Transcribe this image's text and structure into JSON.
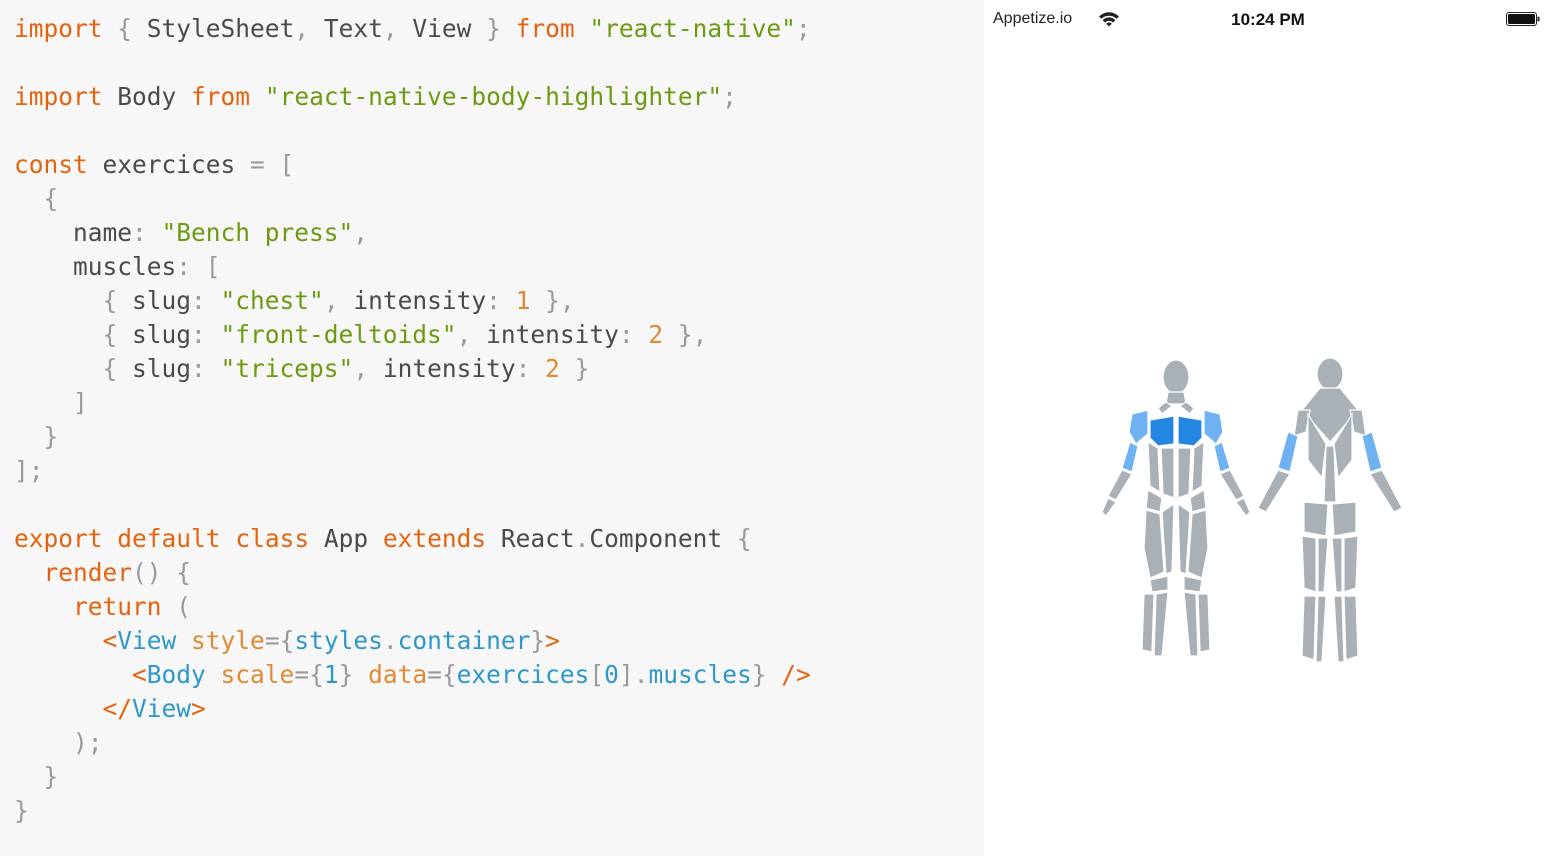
{
  "editor": {
    "lines": [
      [
        {
          "t": "import",
          "c": "kw"
        },
        {
          "t": " { ",
          "c": "punc"
        },
        {
          "t": "StyleSheet",
          "c": "id"
        },
        {
          "t": ", ",
          "c": "punc"
        },
        {
          "t": "Text",
          "c": "id"
        },
        {
          "t": ", ",
          "c": "punc"
        },
        {
          "t": "View",
          "c": "id"
        },
        {
          "t": " } ",
          "c": "punc"
        },
        {
          "t": "from",
          "c": "kw"
        },
        {
          "t": " ",
          "c": "id"
        },
        {
          "t": "\"react-native\"",
          "c": "str"
        },
        {
          "t": ";",
          "c": "punc"
        }
      ],
      [],
      [
        {
          "t": "import",
          "c": "kw"
        },
        {
          "t": " Body ",
          "c": "id"
        },
        {
          "t": "from",
          "c": "kw"
        },
        {
          "t": " ",
          "c": "id"
        },
        {
          "t": "\"react-native-body-highlighter\"",
          "c": "str"
        },
        {
          "t": ";",
          "c": "punc"
        }
      ],
      [],
      [
        {
          "t": "const",
          "c": "kw"
        },
        {
          "t": " exercices ",
          "c": "id"
        },
        {
          "t": "= [",
          "c": "punc"
        }
      ],
      [
        {
          "t": "  {",
          "c": "punc"
        }
      ],
      [
        {
          "t": "    name",
          "c": "id"
        },
        {
          "t": ": ",
          "c": "punc"
        },
        {
          "t": "\"Bench press\"",
          "c": "str"
        },
        {
          "t": ",",
          "c": "punc"
        }
      ],
      [
        {
          "t": "    muscles",
          "c": "id"
        },
        {
          "t": ": [",
          "c": "punc"
        }
      ],
      [
        {
          "t": "      { ",
          "c": "punc"
        },
        {
          "t": "slug",
          "c": "id"
        },
        {
          "t": ": ",
          "c": "punc"
        },
        {
          "t": "\"chest\"",
          "c": "str"
        },
        {
          "t": ", ",
          "c": "punc"
        },
        {
          "t": "intensity",
          "c": "id"
        },
        {
          "t": ": ",
          "c": "punc"
        },
        {
          "t": "1",
          "c": "num"
        },
        {
          "t": " },",
          "c": "punc"
        }
      ],
      [
        {
          "t": "      { ",
          "c": "punc"
        },
        {
          "t": "slug",
          "c": "id"
        },
        {
          "t": ": ",
          "c": "punc"
        },
        {
          "t": "\"front-deltoids\"",
          "c": "str"
        },
        {
          "t": ", ",
          "c": "punc"
        },
        {
          "t": "intensity",
          "c": "id"
        },
        {
          "t": ": ",
          "c": "punc"
        },
        {
          "t": "2",
          "c": "num"
        },
        {
          "t": " },",
          "c": "punc"
        }
      ],
      [
        {
          "t": "      { ",
          "c": "punc"
        },
        {
          "t": "slug",
          "c": "id"
        },
        {
          "t": ": ",
          "c": "punc"
        },
        {
          "t": "\"triceps\"",
          "c": "str"
        },
        {
          "t": ", ",
          "c": "punc"
        },
        {
          "t": "intensity",
          "c": "id"
        },
        {
          "t": ": ",
          "c": "punc"
        },
        {
          "t": "2",
          "c": "num"
        },
        {
          "t": " }",
          "c": "punc"
        }
      ],
      [
        {
          "t": "    ]",
          "c": "punc"
        }
      ],
      [
        {
          "t": "  }",
          "c": "punc"
        }
      ],
      [
        {
          "t": "];",
          "c": "punc"
        }
      ],
      [],
      [
        {
          "t": "export",
          "c": "kw"
        },
        {
          "t": " ",
          "c": "id"
        },
        {
          "t": "default",
          "c": "kw"
        },
        {
          "t": " ",
          "c": "id"
        },
        {
          "t": "class",
          "c": "kw"
        },
        {
          "t": " App ",
          "c": "id"
        },
        {
          "t": "extends",
          "c": "kw"
        },
        {
          "t": " React",
          "c": "id"
        },
        {
          "t": ".",
          "c": "punc"
        },
        {
          "t": "Component",
          "c": "id"
        },
        {
          "t": " {",
          "c": "punc"
        }
      ],
      [
        {
          "t": "  ",
          "c": "id"
        },
        {
          "t": "render",
          "c": "kw"
        },
        {
          "t": "() {",
          "c": "punc"
        }
      ],
      [
        {
          "t": "    ",
          "c": "id"
        },
        {
          "t": "return",
          "c": "kw"
        },
        {
          "t": " (",
          "c": "punc"
        }
      ],
      [
        {
          "t": "      <",
          "c": "kw"
        },
        {
          "t": "View",
          "c": "tag"
        },
        {
          "t": " ",
          "c": "id"
        },
        {
          "t": "style",
          "c": "attr"
        },
        {
          "t": "={",
          "c": "punc"
        },
        {
          "t": "styles",
          "c": "tag"
        },
        {
          "t": ".",
          "c": "punc"
        },
        {
          "t": "container",
          "c": "tag"
        },
        {
          "t": "}",
          "c": "punc"
        },
        {
          "t": ">",
          "c": "kw"
        }
      ],
      [
        {
          "t": "        <",
          "c": "kw"
        },
        {
          "t": "Body",
          "c": "tag"
        },
        {
          "t": " ",
          "c": "id"
        },
        {
          "t": "scale",
          "c": "attr"
        },
        {
          "t": "={",
          "c": "punc"
        },
        {
          "t": "1",
          "c": "tag"
        },
        {
          "t": "} ",
          "c": "punc"
        },
        {
          "t": "data",
          "c": "attr"
        },
        {
          "t": "={",
          "c": "punc"
        },
        {
          "t": "exercices",
          "c": "tag"
        },
        {
          "t": "[",
          "c": "punc"
        },
        {
          "t": "0",
          "c": "tag"
        },
        {
          "t": "].",
          "c": "punc"
        },
        {
          "t": "muscles",
          "c": "tag"
        },
        {
          "t": "} ",
          "c": "punc"
        },
        {
          "t": "/>",
          "c": "kw"
        }
      ],
      [
        {
          "t": "      </",
          "c": "kw"
        },
        {
          "t": "View",
          "c": "tag"
        },
        {
          "t": ">",
          "c": "kw"
        }
      ],
      [
        {
          "t": "    );",
          "c": "punc"
        }
      ],
      [
        {
          "t": "  }",
          "c": "punc"
        }
      ],
      [
        {
          "t": "}",
          "c": "punc"
        }
      ]
    ]
  },
  "device": {
    "carrier": "Appetize.io",
    "wifi_icon": "wifi-icon",
    "time": "10:24 PM",
    "battery_icon": "battery-icon",
    "body_highlighter": {
      "base_color": "#a9b0b6",
      "intensity_colors": [
        "#2486e0",
        "#6fb2f2"
      ],
      "highlighted_muscles": [
        {
          "slug": "chest",
          "intensity": 1
        },
        {
          "slug": "front-deltoids",
          "intensity": 2
        },
        {
          "slug": "triceps",
          "intensity": 2
        }
      ]
    }
  }
}
